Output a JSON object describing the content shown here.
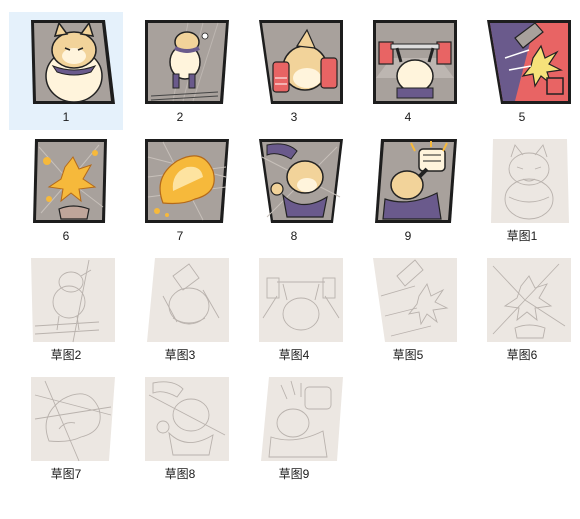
{
  "window": {
    "title": ""
  },
  "files": [
    {
      "label": "1",
      "kind": "color",
      "icon": "comic-panel-1-thumbnail",
      "selected": true
    },
    {
      "label": "2",
      "kind": "color",
      "icon": "comic-panel-2-thumbnail"
    },
    {
      "label": "3",
      "kind": "color",
      "icon": "comic-panel-3-thumbnail"
    },
    {
      "label": "4",
      "kind": "color",
      "icon": "comic-panel-4-thumbnail"
    },
    {
      "label": "5",
      "kind": "color",
      "icon": "comic-panel-5-thumbnail"
    },
    {
      "label": "6",
      "kind": "color",
      "icon": "comic-panel-6-thumbnail"
    },
    {
      "label": "7",
      "kind": "color",
      "icon": "comic-panel-7-thumbnail"
    },
    {
      "label": "8",
      "kind": "color",
      "icon": "comic-panel-8-thumbnail"
    },
    {
      "label": "9",
      "kind": "color",
      "icon": "comic-panel-9-thumbnail"
    },
    {
      "label": "草图1",
      "kind": "sketch",
      "icon": "sketch-1-thumbnail"
    },
    {
      "label": "草图2",
      "kind": "sketch",
      "icon": "sketch-2-thumbnail"
    },
    {
      "label": "草图3",
      "kind": "sketch",
      "icon": "sketch-3-thumbnail"
    },
    {
      "label": "草图4",
      "kind": "sketch",
      "icon": "sketch-4-thumbnail"
    },
    {
      "label": "草图5",
      "kind": "sketch",
      "icon": "sketch-5-thumbnail"
    },
    {
      "label": "草图6",
      "kind": "sketch",
      "icon": "sketch-6-thumbnail"
    },
    {
      "label": "草图7",
      "kind": "sketch",
      "icon": "sketch-7-thumbnail"
    },
    {
      "label": "草图8",
      "kind": "sketch",
      "icon": "sketch-8-thumbnail"
    },
    {
      "label": "草图9",
      "kind": "sketch",
      "icon": "sketch-9-thumbnail"
    }
  ],
  "colors": {
    "selection": "#e5f1fb",
    "panel_bg": "#9a938f",
    "dog_fur": "#f2d39a",
    "dog_light": "#fff4dc",
    "scarf": "#6a5a8c",
    "red_accent": "#e86464",
    "fire": "#f6b93b",
    "sketch_paper": "#ece7e2",
    "sketch_line": "#b9b2ad"
  }
}
